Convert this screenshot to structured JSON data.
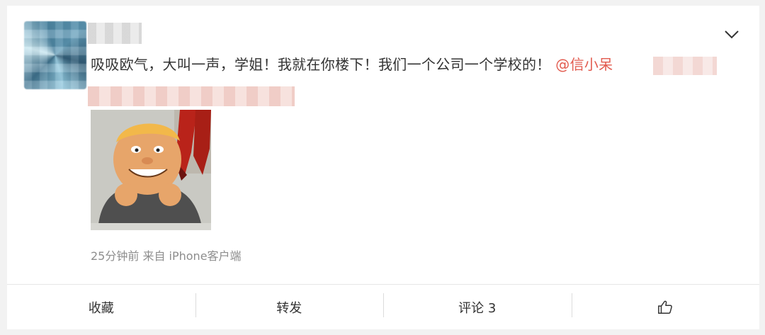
{
  "post": {
    "text_main": "吸吸欧气，大叫一声，学姐！我就在你楼下！我们一个公司一个学校的！",
    "mention": "@信小呆",
    "meta": "25分钟前 来自 iPhone客户端"
  },
  "actions": {
    "collect": "收藏",
    "repost": "转发",
    "comment": "评论 3"
  },
  "icons": {
    "menu": "chevron-down-icon",
    "like": "thumbs-up-icon"
  },
  "colors": {
    "mention": "#e25b4f",
    "text": "#333333",
    "meta": "#8d8d8d"
  }
}
